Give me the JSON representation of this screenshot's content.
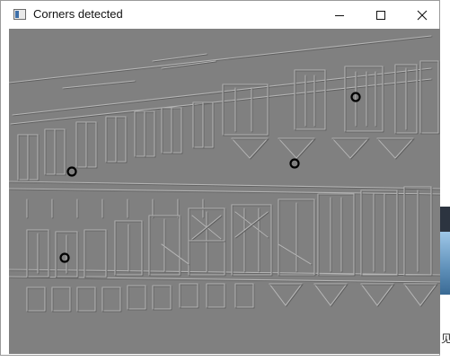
{
  "window": {
    "title": "Corners detected",
    "controls": {
      "minimize_icon": "minimize-icon",
      "maximize_icon": "maximize-icon",
      "close_icon": "close-icon"
    }
  },
  "image": {
    "description_kind": "edge-filtered building facade",
    "background_color": "#808080",
    "corner_marker_color": "#000000",
    "corner_count": 4
  },
  "desktop": {
    "partial_glyph": "见"
  }
}
